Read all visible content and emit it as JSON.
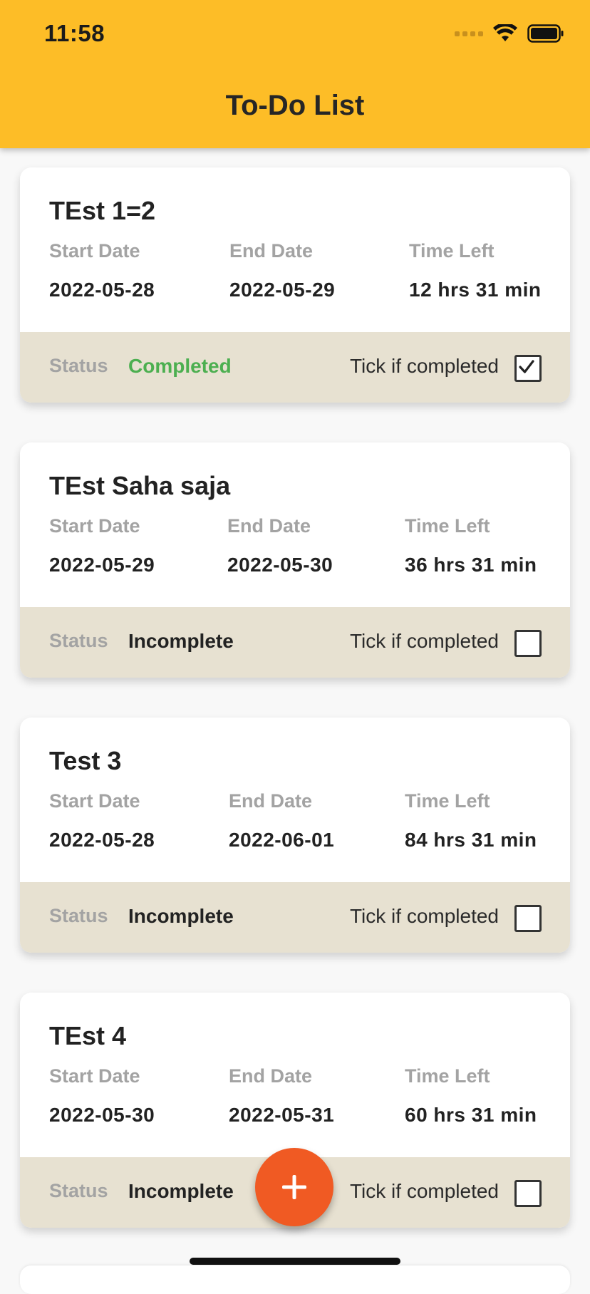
{
  "status_bar": {
    "time": "11:58"
  },
  "app_bar": {
    "title": "To-Do List"
  },
  "labels": {
    "start_date": "Start Date",
    "end_date": "End Date",
    "time_left": "Time Left",
    "status": "Status",
    "tick_if_completed": "Tick if completed"
  },
  "tasks": [
    {
      "title": "TEst 1=2",
      "start_date": "2022-05-28",
      "end_date": "2022-05-29",
      "time_left": "12 hrs 31 min",
      "status": "Completed",
      "checked": true
    },
    {
      "title": "TEst Saha saja",
      "start_date": "2022-05-29",
      "end_date": "2022-05-30",
      "time_left": "36 hrs 31 min",
      "status": "Incomplete",
      "checked": false
    },
    {
      "title": "Test 3",
      "start_date": "2022-05-28",
      "end_date": "2022-06-01",
      "time_left": "84 hrs 31 min",
      "status": "Incomplete",
      "checked": false
    },
    {
      "title": "TEst 4",
      "start_date": "2022-05-30",
      "end_date": "2022-05-31",
      "time_left": "60 hrs 31 min",
      "status": "Incomplete",
      "checked": false
    }
  ],
  "colors": {
    "app_bar": "#fdbd27",
    "card_footer": "#e7e1d1",
    "completed_status": "#4caf50",
    "fab": "#f05a23"
  },
  "icons": {
    "fab": "plus-icon",
    "checkbox_checked": "checkmark-icon",
    "wifi": "wifi-icon",
    "battery": "battery-icon",
    "signal": "signal-icon"
  }
}
